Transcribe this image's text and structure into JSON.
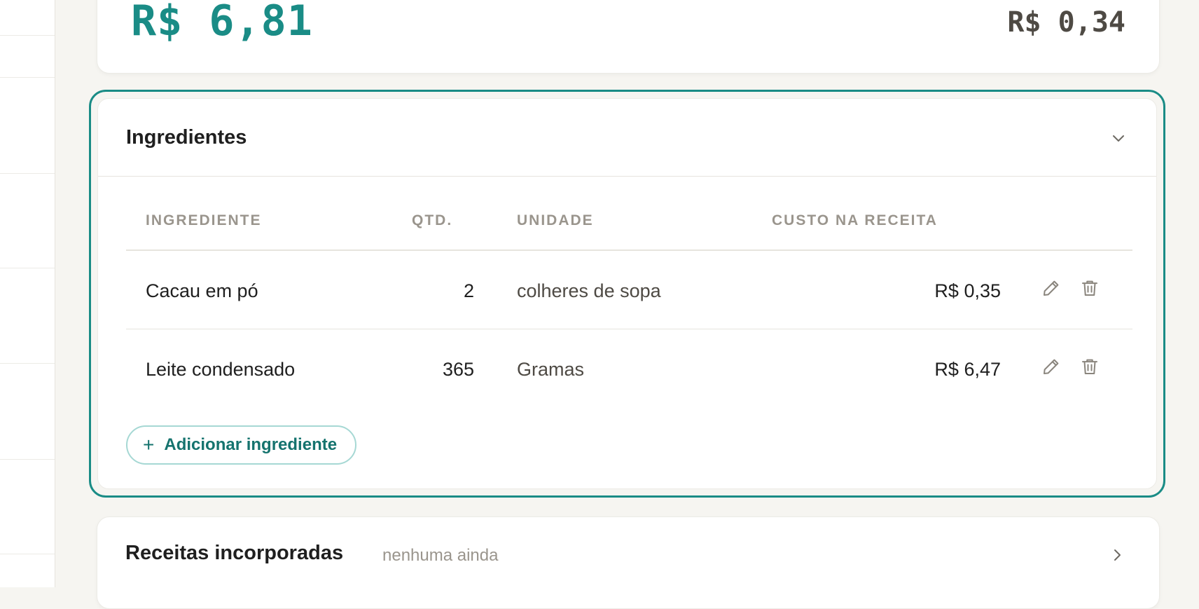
{
  "summary": {
    "total_cost": "R$ 6,81",
    "unit_cost": "R$ 0,34"
  },
  "ingredients": {
    "title": "Ingredientes",
    "columns": [
      "INGREDIENTE",
      "QTD.",
      "UNIDADE",
      "CUSTO NA RECEITA"
    ],
    "rows": [
      {
        "name": "Cacau em pó",
        "qty": "2",
        "unit": "colheres de sopa",
        "cost": "R$ 0,35"
      },
      {
        "name": "Leite condensado",
        "qty": "365",
        "unit": "Gramas",
        "cost": "R$ 6,47"
      }
    ],
    "add_button": {
      "icon": "+",
      "label": "Adicionar ingrediente"
    }
  },
  "incorporated_recipes": {
    "title": "Receitas incorporadas",
    "subtitle": "nenhuma ainda"
  },
  "colors": {
    "accent": "#1a8c86",
    "accent_dark": "#15736e",
    "muted_text": "#9a958d",
    "background": "#f6f5f1"
  },
  "icons": {
    "section_toggle": "chevron-down-icon",
    "edit": "pencil-icon",
    "delete": "trash-icon",
    "expand": "chevron-right-icon"
  }
}
